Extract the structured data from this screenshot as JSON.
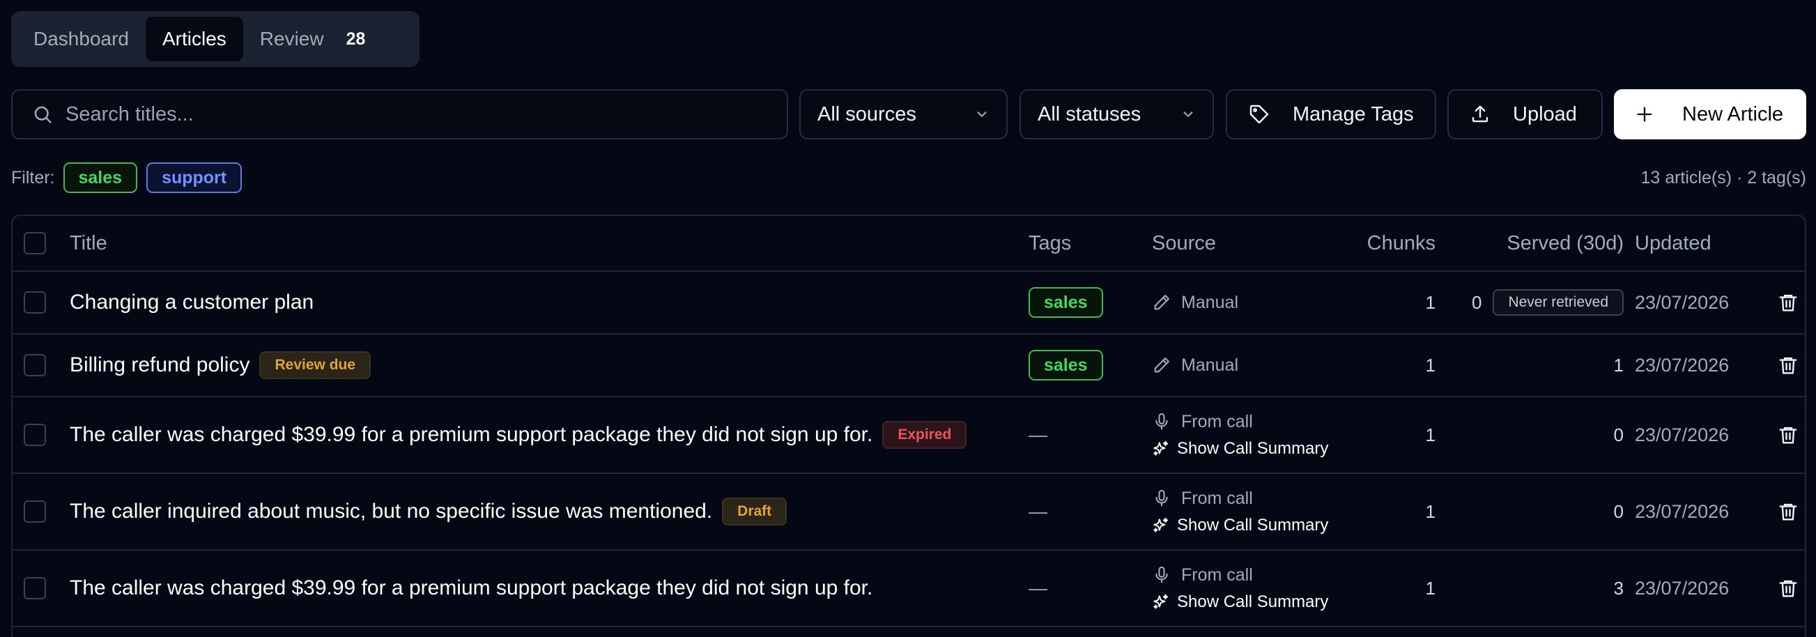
{
  "tabs": {
    "items": [
      {
        "label": "Dashboard",
        "active": false
      },
      {
        "label": "Articles",
        "active": true
      },
      {
        "label": "Review",
        "active": false,
        "count": "28"
      }
    ]
  },
  "toolbar": {
    "search_placeholder": "Search titles...",
    "sources_value": "All sources",
    "statuses_value": "All statuses",
    "manage_tags_label": "Manage Tags",
    "upload_label": "Upload",
    "new_article_label": "New Article"
  },
  "filter": {
    "label": "Filter:",
    "chips": [
      "sales",
      "support"
    ],
    "summary": "13 article(s) · 2 tag(s)"
  },
  "table": {
    "headers": {
      "title": "Title",
      "tags": "Tags",
      "source": "Source",
      "chunks": "Chunks",
      "served": "Served (30d)",
      "updated": "Updated"
    },
    "rows": [
      {
        "title": "Changing a customer plan",
        "badge": "",
        "tag": "sales",
        "source": "Manual",
        "source_icon": "pencil-icon",
        "summary_link": "",
        "chunks": "1",
        "served": "0",
        "served_badge": "Never retrieved",
        "updated": "23/07/2026"
      },
      {
        "title": "Billing refund policy",
        "badge": "Review due",
        "tag": "sales",
        "source": "Manual",
        "source_icon": "pencil-icon",
        "summary_link": "",
        "chunks": "1",
        "served": "1",
        "served_badge": "",
        "updated": "23/07/2026"
      },
      {
        "title": "The caller was charged $39.99 for a premium support package they did not sign up for.",
        "badge": "Expired",
        "tag": "—",
        "source": "From call",
        "source_icon": "microphone-icon",
        "summary_link": "Show Call Summary",
        "chunks": "1",
        "served": "0",
        "served_badge": "",
        "updated": "23/07/2026"
      },
      {
        "title": "The caller inquired about music, but no specific issue was mentioned.",
        "badge": "Draft",
        "tag": "—",
        "source": "From call",
        "source_icon": "microphone-icon",
        "summary_link": "Show Call Summary",
        "chunks": "1",
        "served": "0",
        "served_badge": "",
        "updated": "23/07/2026"
      },
      {
        "title": "The caller was charged $39.99 for a premium support package they did not sign up for.",
        "badge": "",
        "tag": "—",
        "source": "From call",
        "source_icon": "microphone-icon",
        "summary_link": "Show Call Summary",
        "chunks": "1",
        "served": "3",
        "served_badge": "",
        "updated": "23/07/2026"
      }
    ]
  },
  "colors": {
    "background": "#030814",
    "sales_green": "#4ad461",
    "support_blue": "#6f93ff",
    "review_amber": "#e0a336",
    "expired_red": "#f05060"
  }
}
